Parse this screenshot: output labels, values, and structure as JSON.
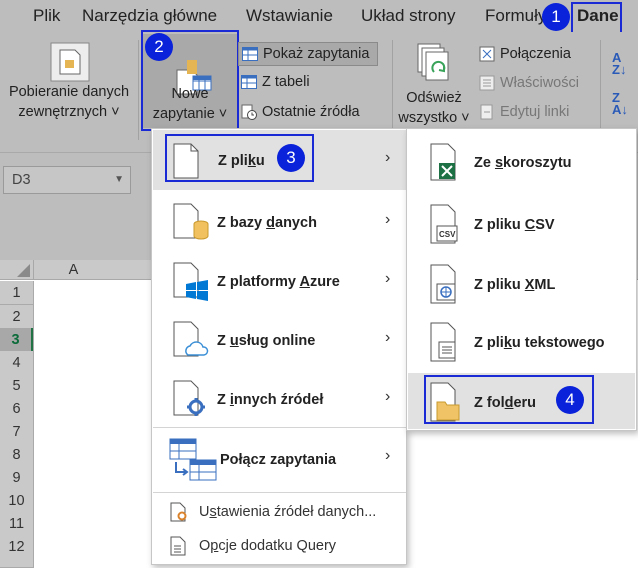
{
  "tabs": [
    "Plik",
    "Narzędzia główne",
    "Wstawianie",
    "Układ strony",
    "Formuły",
    "Dane"
  ],
  "ribbon": {
    "external_data": [
      "Pobieranie danych",
      "zewnętrznych ˅"
    ],
    "new_query": [
      "Nowe",
      "zapytanie ˅"
    ],
    "queries": [
      "Pokaż zapytania",
      "Z tabeli",
      "Ostatnie źródła"
    ],
    "refresh": [
      "Odśwież",
      "wszystko ˅"
    ],
    "connections": [
      "Połączenia",
      "Właściwości",
      "Edytuj linki"
    ]
  },
  "namebox": "D3",
  "column_a": "A",
  "rows": [
    "1",
    "2",
    "3",
    "4",
    "5",
    "6",
    "7",
    "8",
    "9",
    "10",
    "11",
    "12"
  ],
  "menu": {
    "items": [
      {
        "pre": "Z pli",
        "u": "k",
        "post": "u"
      },
      {
        "pre": "Z bazy ",
        "u": "d",
        "post": "anych"
      },
      {
        "pre": "Z platformy ",
        "u": "A",
        "post": "zure"
      },
      {
        "pre": "Z ",
        "u": "u",
        "post": "sług online"
      },
      {
        "pre": "Z ",
        "u": "i",
        "post": "nnych źródeł"
      },
      {
        "pre": "Połącz zapytania",
        "u": "",
        "post": ""
      },
      {
        "pre": "U",
        "u": "s",
        "post": "tawienia źródeł danych..."
      },
      {
        "pre": "O",
        "u": "p",
        "post": "cje dodatku Query"
      }
    ]
  },
  "submenu": {
    "items": [
      {
        "pre": "Ze ",
        "u": "s",
        "post": "koroszytu"
      },
      {
        "pre": "Z pliku ",
        "u": "C",
        "post": "SV"
      },
      {
        "pre": "Z pliku ",
        "u": "X",
        "post": "ML"
      },
      {
        "pre": "Z pli",
        "u": "k",
        "post": "u tekstowego"
      },
      {
        "pre": "Z fol",
        "u": "d",
        "post": "eru"
      }
    ]
  },
  "doc_icon_labels": {
    "csv": "CSV"
  },
  "badges": [
    "1",
    "2",
    "3",
    "4"
  ],
  "colors": {
    "accent": "#0a22d9",
    "excel_green": "#217346",
    "folder": "#f0c466",
    "db": "#f2c15f",
    "azure": "#0078d4"
  }
}
